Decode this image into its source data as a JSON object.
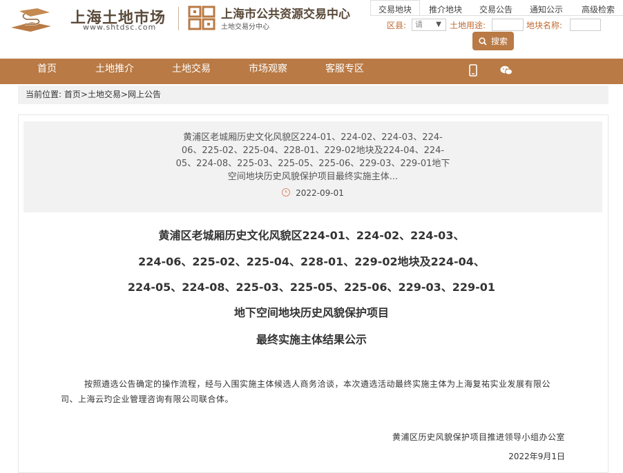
{
  "header": {
    "logo1_title": "上海土地市场",
    "logo1_url": "www.shtdsc.com",
    "logo2_title": "上海市公共资源交易中心",
    "logo2_sub": "土地交易分中心",
    "brand_color": "#b97a45"
  },
  "tabs": [
    "交易地块",
    "推介地块",
    "交易公告",
    "通知公示",
    "高级检索"
  ],
  "filters": {
    "district_label": "区县:",
    "district_value": "请",
    "use_label": "土地用途:",
    "name_label": "地块名称:",
    "search_label": "搜索"
  },
  "nav": {
    "items": [
      "首页",
      "土地推介",
      "土地交易",
      "市场观察",
      "客服专区"
    ],
    "icons": [
      "mobile-icon",
      "wechat-icon"
    ]
  },
  "breadcrumb": {
    "prefix": "当前位置:",
    "items": [
      "首页",
      "土地交易",
      "网上公告"
    ],
    "sep": ">"
  },
  "summary": {
    "text": "黄浦区老城厢历史文化风貌区224-01、224-02、224-03、224-06、225-02、225-04、228-01、229-02地块及224-04、224-05、224-08、225-03、225-05、225-06、229-03、229-01地下空间地块历史风貌保护项目最终实施主体...",
    "date": "2022-09-01"
  },
  "article": {
    "title_lines": [
      "黄浦区老城厢历史文化风貌区224-01、224-02、224-03、",
      "224-06、225-02、225-04、228-01、229-02地块及224-04、",
      "224-05、224-08、225-03、225-05、225-06、229-03、229-01",
      "地下空间地块历史风貌保护项目",
      "最终实施主体结果公示"
    ],
    "body": "按照遴选公告确定的操作流程，经与入围实施主体候选人商务洽谈，本次遴选活动最终实施主体为上海复祐实业发展有限公司、上海云玓企业管理咨询有限公司联合体。",
    "signature": "黄浦区历史风貌保护项目推进领导小组办公室",
    "sign_date": "2022年9月1日"
  }
}
